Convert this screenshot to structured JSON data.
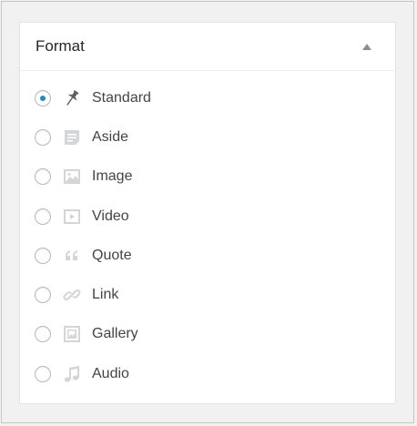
{
  "panel": {
    "title": "Format",
    "selected": "standard",
    "formats": [
      {
        "id": "standard",
        "label": "Standard",
        "icon": "pushpin-icon"
      },
      {
        "id": "aside",
        "label": "Aside",
        "icon": "aside-icon"
      },
      {
        "id": "image",
        "label": "Image",
        "icon": "image-icon"
      },
      {
        "id": "video",
        "label": "Video",
        "icon": "video-icon"
      },
      {
        "id": "quote",
        "label": "Quote",
        "icon": "quote-icon"
      },
      {
        "id": "link",
        "label": "Link",
        "icon": "link-icon"
      },
      {
        "id": "gallery",
        "label": "Gallery",
        "icon": "gallery-icon"
      },
      {
        "id": "audio",
        "label": "Audio",
        "icon": "audio-icon"
      }
    ]
  },
  "colors": {
    "radio_checked": "#1e8cbe",
    "icon_active": "#555d66",
    "icon_muted": "#d3d5d8"
  }
}
